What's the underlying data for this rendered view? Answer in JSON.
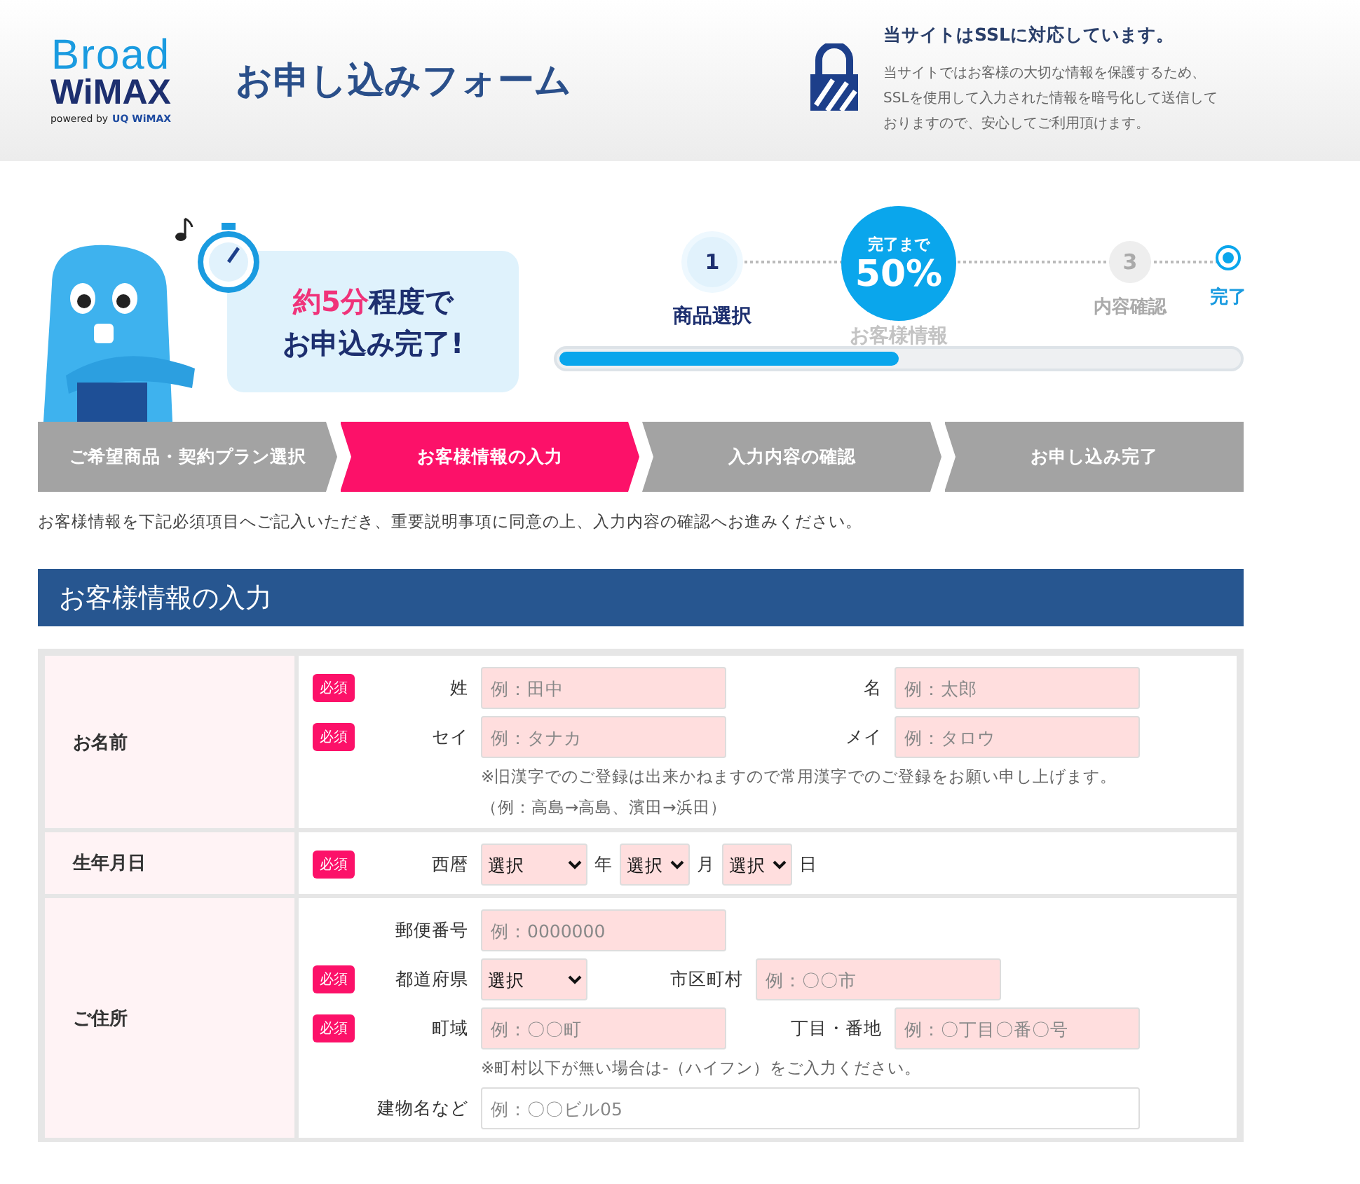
{
  "header": {
    "logo_top": "Broad",
    "logo_main": "WiMAX",
    "logo_powered": "powered by",
    "logo_uq": "UQ WiMAX",
    "title": "お申し込みフォーム",
    "ssl_title": "当サイトはSSLに対応しています。",
    "ssl_text": "当サイトではお客様の大切な情報を保護するため、SSLを使用して入力された情報を暗号化して送信しておりますので、安心してご利用頂けます。"
  },
  "speech": {
    "lines": [
      [
        {
          "text": "約",
          "highlight": true
        },
        {
          "text": "5分",
          "highlight": true
        },
        {
          "text": "程度で",
          "highlight": false
        }
      ],
      [
        {
          "text": "お申込み完了!",
          "highlight": false
        }
      ]
    ]
  },
  "progress": {
    "steps": [
      {
        "number": "1",
        "label": "商品選択",
        "kind": "done"
      },
      {
        "label": "お客様情報",
        "kind": "current",
        "bubble_top": "完了まで",
        "bubble_value": "50%"
      },
      {
        "number": "3",
        "label": "内容確認",
        "kind": "pending"
      },
      {
        "label": "完了",
        "kind": "goal"
      }
    ],
    "level": 0.5
  },
  "tabs": [
    {
      "label": "ご希望商品・契約プラン選択",
      "selected": false
    },
    {
      "label": "お客様情報の入力",
      "selected": true
    },
    {
      "label": "入力内容の確認",
      "selected": false
    },
    {
      "label": "お申し込み完了",
      "selected": false
    }
  ],
  "intro": "お客様情報を下記必須項目へご記入いただき、重要説明事項に同意の上、入力内容の確認へお進みください。",
  "section_title": "お客様情報の入力",
  "form_rows": [
    {
      "label": "お名前",
      "lines": [
        {
          "kind": "pairs",
          "required": true,
          "badge": "必須",
          "pairs": [
            {
              "label": "姓",
              "control": {
                "kind": "input",
                "placeholder": "例：田中"
              }
            },
            {
              "label": "名",
              "control": {
                "kind": "input",
                "placeholder": "例：太郎"
              }
            }
          ]
        },
        {
          "kind": "pairs",
          "required": true,
          "badge": "必須",
          "pairs": [
            {
              "label": "セイ",
              "control": {
                "kind": "input",
                "placeholder": "例：タナカ"
              }
            },
            {
              "label": "メイ",
              "control": {
                "kind": "input",
                "placeholder": "例：タロウ"
              }
            }
          ]
        }
      ],
      "notes": [
        "※旧漢字でのご登録は出来かねますので常用漢字でのご登録をお願い申し上げます。",
        "（例：高島→高島、濱田→浜田）"
      ]
    },
    {
      "label": "生年月日",
      "lines": [
        {
          "kind": "inline",
          "required": true,
          "badge": "必須",
          "label": "西暦",
          "items": [
            {
              "kind": "select",
              "value": "選択"
            },
            {
              "kind": "unit",
              "text": "年"
            },
            {
              "kind": "select-small",
              "value": "選択"
            },
            {
              "kind": "unit",
              "text": "月"
            },
            {
              "kind": "select-small",
              "value": "選択"
            },
            {
              "kind": "unit",
              "text": "日"
            }
          ]
        }
      ],
      "notes": []
    },
    {
      "label": "ご住所",
      "lines": [
        {
          "kind": "pairs",
          "required": false,
          "pairs": [
            {
              "label": "郵便番号",
              "control": {
                "kind": "input",
                "placeholder": "例：0000000"
              }
            }
          ]
        },
        {
          "kind": "pairs",
          "required": true,
          "badge": "必須",
          "pairs": [
            {
              "label": "都道府県",
              "control": {
                "kind": "select",
                "value": "選択"
              }
            },
            {
              "label": "市区町村",
              "control": {
                "kind": "input",
                "placeholder": "例：〇〇市"
              }
            }
          ]
        },
        {
          "kind": "pairs",
          "required": true,
          "badge": "必須",
          "pairs": [
            {
              "label": "町域",
              "control": {
                "kind": "input",
                "placeholder": "例：〇〇町"
              }
            },
            {
              "label": "丁目・番地",
              "control": {
                "kind": "input",
                "placeholder": "例：〇丁目〇番〇号"
              }
            }
          ]
        },
        {
          "kind": "note",
          "text": "※町村以下が無い場合は-（ハイフン）をご入力ください。"
        },
        {
          "kind": "pairs",
          "required": false,
          "pairs": [
            {
              "label": "建物名など",
              "control": {
                "kind": "input-wide",
                "placeholder": "例：〇〇ビル05"
              }
            }
          ]
        }
      ],
      "notes": []
    }
  ]
}
